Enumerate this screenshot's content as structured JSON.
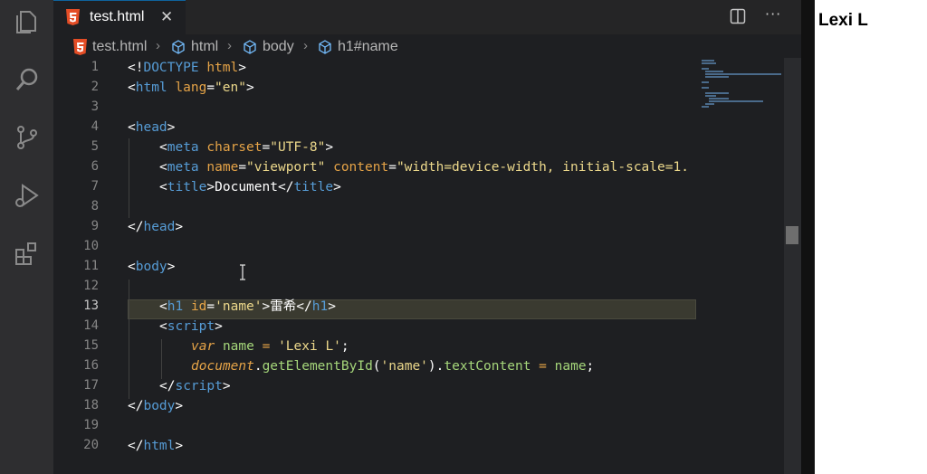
{
  "tab": {
    "title": "test.html",
    "close": "✕",
    "more": "···"
  },
  "breadcrumb": {
    "file": "test.html",
    "html": "html",
    "body": "body",
    "h1": "h1#name",
    "sep": "›"
  },
  "line_numbers": [
    "1",
    "2",
    "3",
    "4",
    "5",
    "6",
    "7",
    "8",
    "9",
    "10",
    "11",
    "12",
    "13",
    "14",
    "15",
    "16",
    "17",
    "18",
    "19",
    "20"
  ],
  "code": {
    "l1": [
      "<!",
      "DOCTYPE",
      " ",
      "html",
      ">"
    ],
    "l2": [
      "<",
      "html",
      " ",
      "lang",
      "=",
      "\"en\"",
      ">"
    ],
    "l4": [
      "<",
      "head",
      ">"
    ],
    "l5": [
      "<",
      "meta",
      " ",
      "charset",
      "=",
      "\"UTF-8\"",
      ">"
    ],
    "l6": [
      "<",
      "meta",
      " ",
      "name",
      "=",
      "\"viewport\"",
      " ",
      "content",
      "=",
      "\"width=device-width, initial-scale=1."
    ],
    "l7": [
      "<",
      "title",
      ">",
      "Document",
      "</",
      "title",
      ">"
    ],
    "l9": [
      "</",
      "head",
      ">"
    ],
    "l11": [
      "<",
      "body",
      ">"
    ],
    "l13": [
      "<",
      "h1",
      " ",
      "id",
      "=",
      "'name'",
      ">",
      "雷希",
      "</",
      "h1",
      ">"
    ],
    "l14": [
      "<",
      "script",
      ">"
    ],
    "l15": [
      "var",
      " ",
      "name",
      " = ",
      "'Lexi L'",
      ";"
    ],
    "l16": [
      "document",
      ".",
      "getElementById",
      "(",
      "'name'",
      ")",
      ".",
      "textContent",
      " = ",
      "name",
      ";"
    ],
    "l17": [
      "</",
      "script",
      ">"
    ],
    "l18": [
      "</",
      "body",
      ">"
    ],
    "l20": [
      "</",
      "html",
      ">"
    ]
  },
  "preview": {
    "heading": "Lexi L"
  },
  "colors": {
    "tag": "#569cd6",
    "attr": "#e5a347",
    "string": "#ecd88b",
    "function": "#a5d67a"
  }
}
